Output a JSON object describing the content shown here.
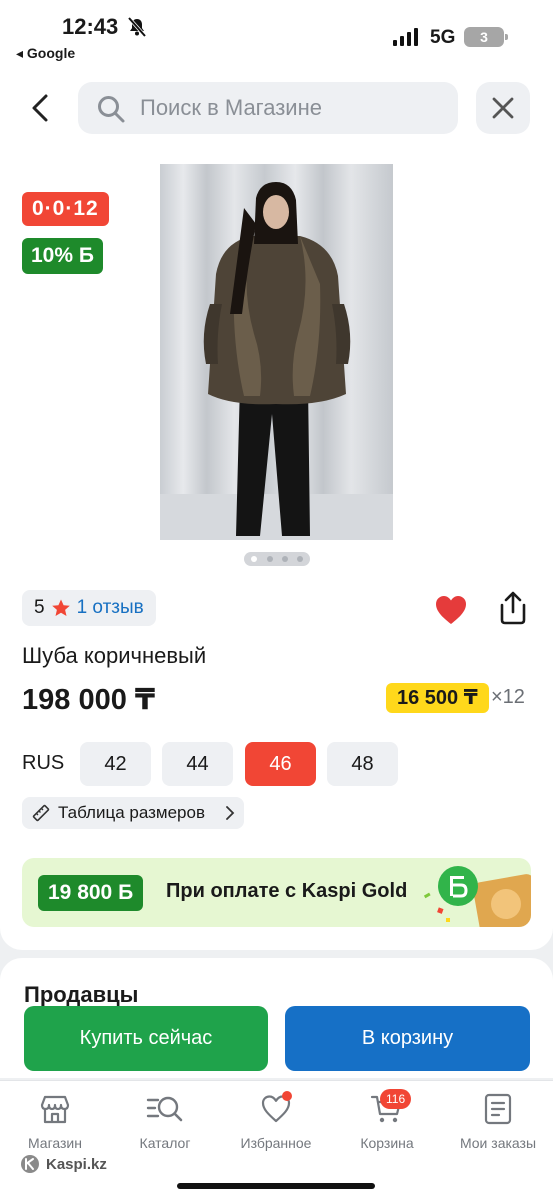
{
  "status_bar": {
    "time": "12:43",
    "back_app": "◂ Google",
    "network": "5G",
    "battery": "3"
  },
  "header": {
    "search_placeholder": "Поиск в Магазине"
  },
  "product": {
    "timer_badge": "0·0·12",
    "bonus_badge": "10% Б",
    "rating_value": "5",
    "reviews_link": "1 отзыв",
    "title": "Шуба коричневый",
    "price": "198 000 ₸",
    "installment_price": "16 500 ₸",
    "installment_months": "×12",
    "size_label": "RUS",
    "sizes": [
      "42",
      "44",
      "46",
      "48"
    ],
    "selected_size": "46",
    "size_table_link": "Таблица размеров",
    "photo_count": 4,
    "active_photo": 1
  },
  "promo": {
    "bonus_amount": "19 800 Б",
    "text": "При оплате с Kaspi Gold"
  },
  "sellers": {
    "title": "Продавцы"
  },
  "actions": {
    "buy_now": "Купить сейчас",
    "add_to_cart": "В корзину"
  },
  "tabbar": {
    "items": [
      {
        "label": "Магазин",
        "icon": "store-icon"
      },
      {
        "label": "Каталог",
        "icon": "catalog-search-icon"
      },
      {
        "label": "Избранное",
        "icon": "heart-icon"
      },
      {
        "label": "Корзина",
        "icon": "cart-icon"
      },
      {
        "label": "Мои заказы",
        "icon": "orders-icon"
      }
    ],
    "cart_count": "116"
  },
  "watermark": "Kaspi.kz",
  "colors": {
    "accent_red": "#f14635",
    "kaspi_green": "#1e8a2b",
    "buy_green": "#1fa34b",
    "cart_blue": "#1670c6",
    "installment_yellow": "#ffd81b",
    "link_blue": "#1770c2"
  }
}
